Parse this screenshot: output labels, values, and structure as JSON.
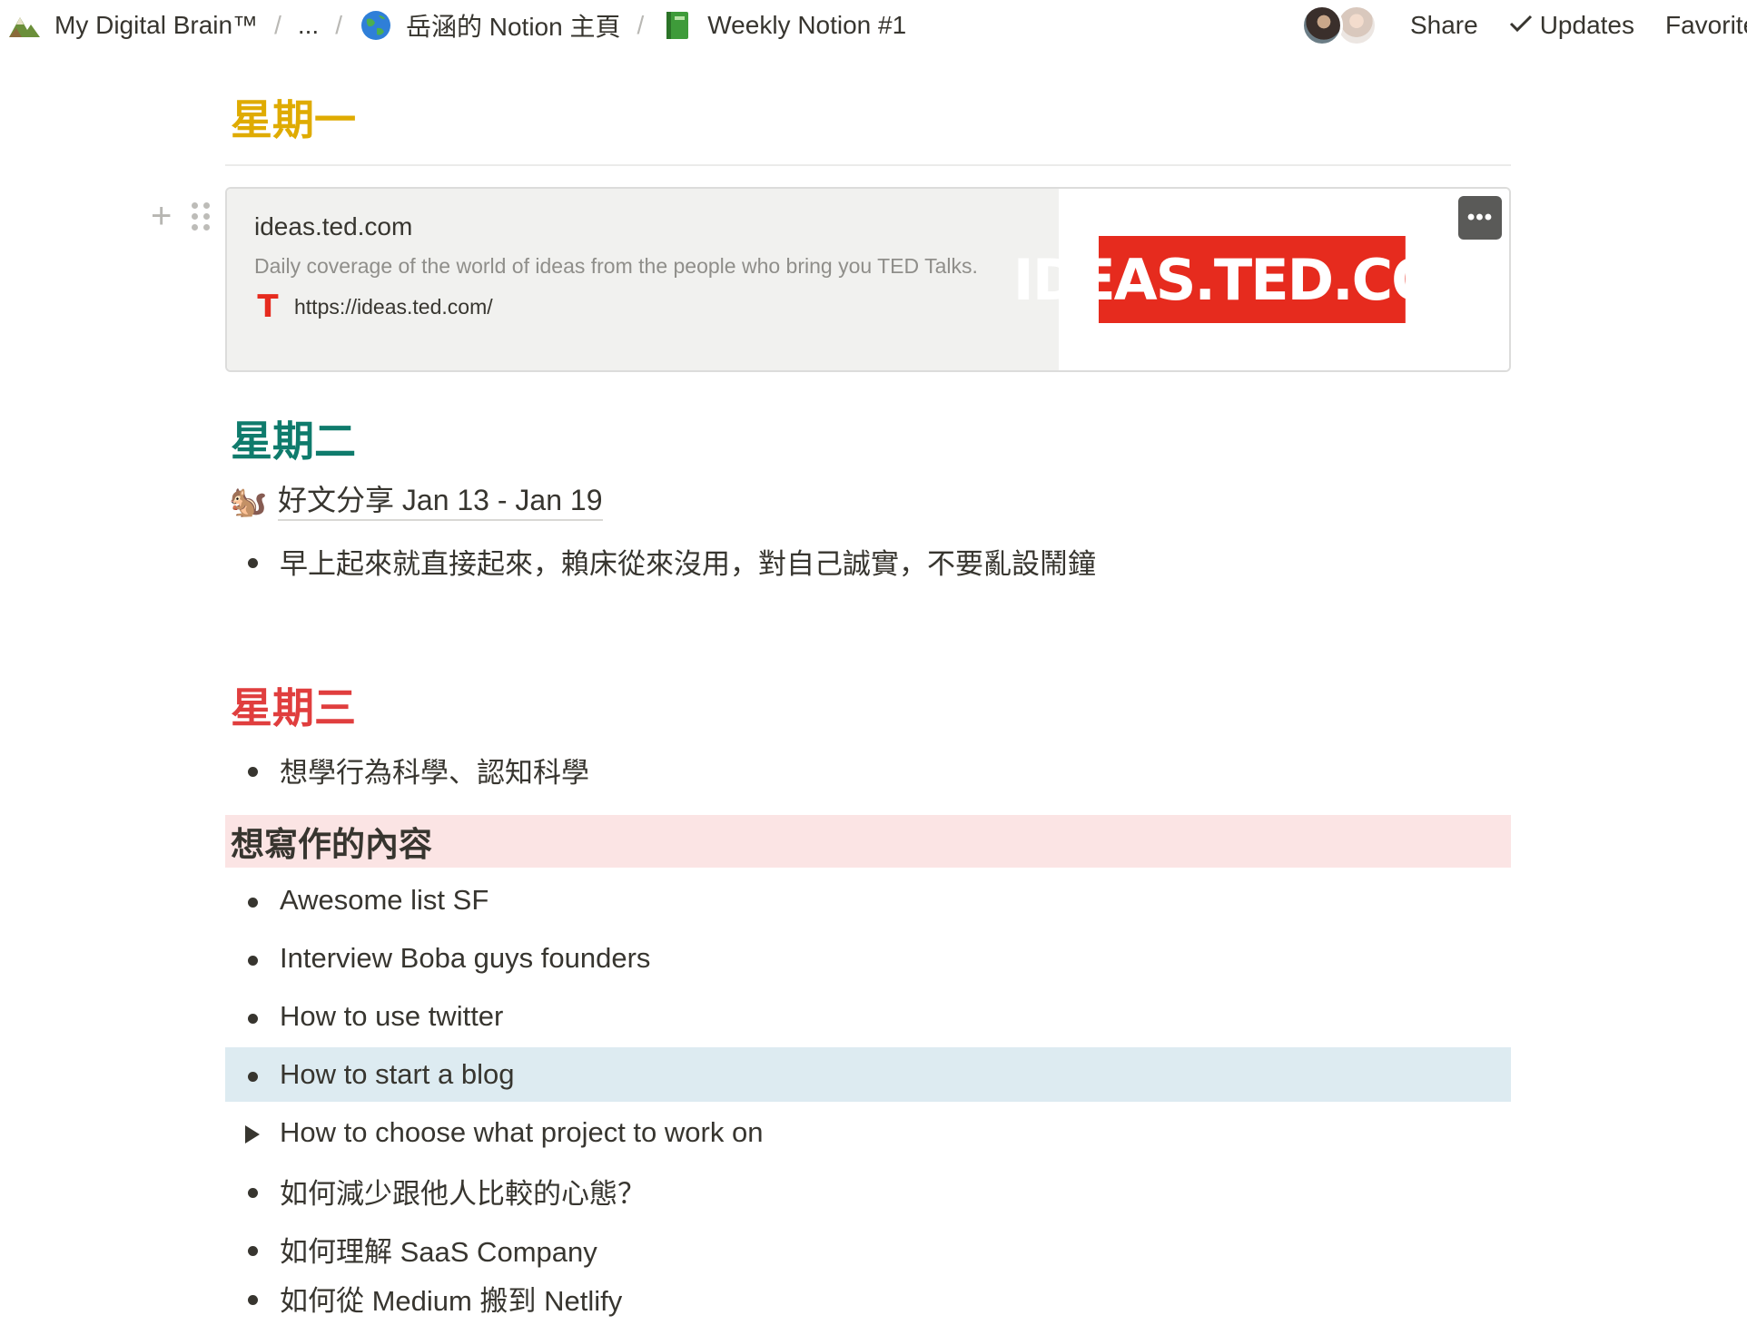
{
  "breadcrumb": {
    "items": [
      {
        "icon": "mountain-icon",
        "label": "My Digital Brain™"
      },
      {
        "icon": "",
        "label": "..."
      },
      {
        "icon": "globe-icon",
        "label": "岳涵的 Notion 主頁"
      },
      {
        "icon": "green-book-icon",
        "label": "Weekly Notion #1"
      }
    ],
    "separator": "/"
  },
  "header_actions": {
    "share_label": "Share",
    "updates_label": "Updates",
    "favorite_label": "Favorite"
  },
  "monday": {
    "heading": "星期一",
    "color": "#dfab01",
    "bookmark": {
      "title": "ideas.ted.com",
      "description": "Daily coverage of the world of ideas from the people who bring you TED Talks.",
      "url": "https://ideas.ted.com/",
      "favicon": "T",
      "image_text": "IDEAS.TED.COM",
      "more_label": "•••"
    }
  },
  "tuesday": {
    "heading": "星期二",
    "color": "#0f7b6c",
    "linked_page": {
      "icon": "🐿️",
      "title": "好文分享 Jan 13 - Jan 19"
    },
    "bullets": [
      "早上起來就直接起來，賴床從來沒用，對自己誠實，不要亂設鬧鐘"
    ]
  },
  "wednesday": {
    "heading": "星期三",
    "color": "#e03e3e",
    "bullets": [
      "想學行為科學、認知科學"
    ]
  },
  "writing": {
    "heading": "想寫作的內容",
    "background": "#fbe4e4",
    "items": [
      "Awesome list SF",
      "Interview Boba guys founders",
      "How to use twitter",
      "How to start a blog",
      "How to choose what project to work on",
      "如何減少跟他人比較的心態？",
      "如何理解 SaaS Company",
      "如何從 Medium 搬到 Netlify"
    ]
  }
}
